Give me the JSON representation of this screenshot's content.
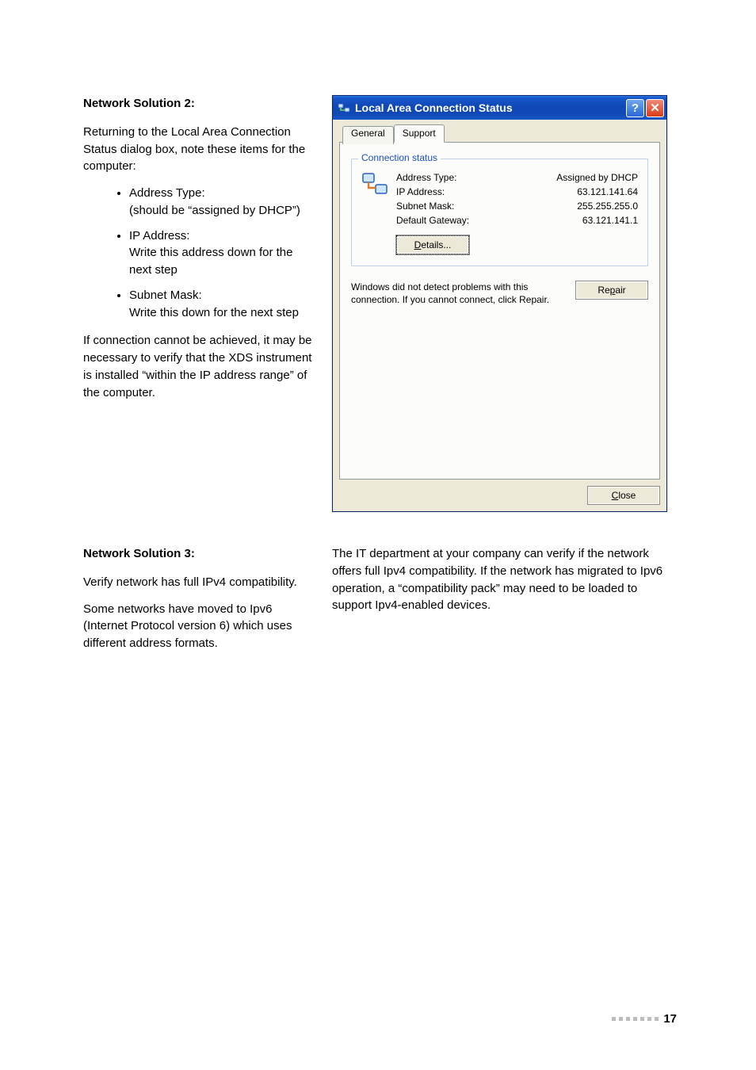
{
  "section2": {
    "heading": "Network Solution 2:",
    "intro": "Returning to the Local Area Connection Status dialog box, note these items for the computer:",
    "bullets": [
      {
        "title": "Address Type:",
        "sub": "(should be “assigned by DHCP”)"
      },
      {
        "title": "IP Address:",
        "sub": "Write this address down for the next step"
      },
      {
        "title": "Subnet Mask:",
        "sub": "Write this down for the next step"
      }
    ],
    "outro": "If connection cannot be achieved, it may be necessary to verify that the XDS instrument is installed “within the IP address range” of the computer."
  },
  "dialog": {
    "title": "Local Area Connection Status",
    "help_symbol": "?",
    "close_symbol": "✕",
    "tabs": {
      "general": "General",
      "support": "Support"
    },
    "group_legend": "Connection status",
    "rows": {
      "address_type": {
        "label": "Address Type:",
        "value": "Assigned by DHCP"
      },
      "ip_address": {
        "label": "IP Address:",
        "value": "63.121.141.64"
      },
      "subnet_mask": {
        "label": "Subnet Mask:",
        "value": "255.255.255.0"
      },
      "gateway": {
        "label": "Default Gateway:",
        "value": "63.121.141.1"
      }
    },
    "details_btn": {
      "ul": "D",
      "rest": "etails..."
    },
    "repair_text": "Windows did not detect problems with this connection. If you cannot connect, click Repair.",
    "repair_btn": {
      "pre": "Re",
      "ul": "p",
      "post": "air"
    },
    "close_btn": {
      "ul": "C",
      "rest": "lose"
    }
  },
  "section3": {
    "heading": "Network Solution 3:",
    "p1": "Verify network has full IPv4 compatibility.",
    "p2": "Some networks have moved to Ipv6 (Internet Protocol version 6) which uses different address formats.",
    "right": "The IT department at your company can verify if the network offers full Ipv4 compatibility. If the network has migrated to Ipv6 operation, a “compatibility pack” may need to be loaded to support Ipv4-enabled devices."
  },
  "page_number": "17"
}
